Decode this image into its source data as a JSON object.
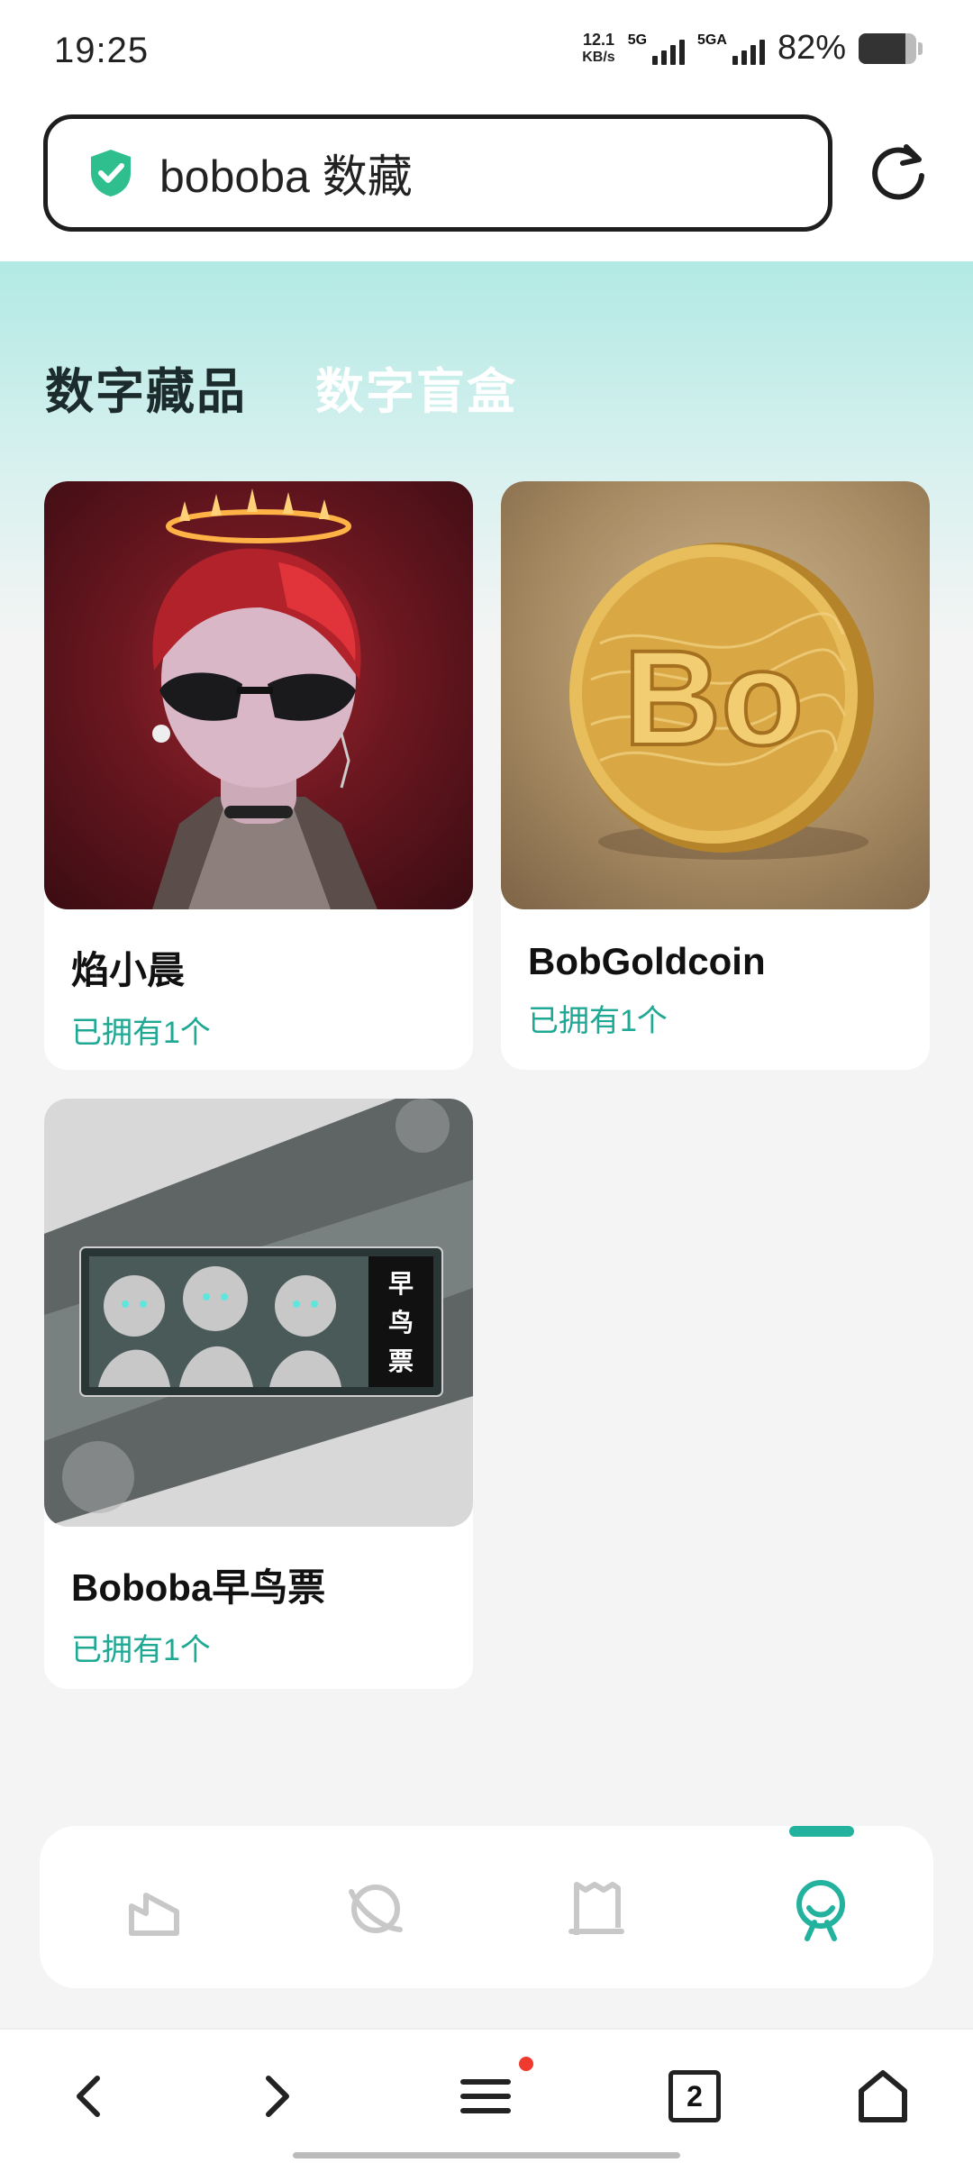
{
  "status_bar": {
    "time": "19:25",
    "net_speed_value": "12.1",
    "net_speed_unit": "KB/s",
    "sim1_label": "5G",
    "sim2_label": "5GA",
    "battery_percent_text": "82%",
    "battery_level": 0.82
  },
  "address_bar": {
    "url_text": "boboba 数藏",
    "secure_icon": "shield-check-icon",
    "reload_icon": "reload-icon"
  },
  "category_tabs": [
    {
      "label": "数字藏品",
      "active": true
    },
    {
      "label": "数字盲盒",
      "active": false
    }
  ],
  "collectibles": [
    {
      "name": "焰小晨",
      "owned": "已拥有1个",
      "image": "avatar-character-artwork"
    },
    {
      "name": "BobGoldcoin",
      "owned": "已拥有1个",
      "image": "gold-coin-artwork"
    },
    {
      "name": "Boboba早鸟票",
      "owned": "已拥有1个",
      "image": "early-bird-ticket-artwork",
      "ticket_text": "早鸟票"
    }
  ],
  "bottom_tabs": [
    {
      "icon": "home-icon",
      "active": false
    },
    {
      "icon": "planet-icon",
      "active": false
    },
    {
      "icon": "receipt-icon",
      "active": false
    },
    {
      "icon": "profile-icon",
      "active": true
    }
  ],
  "browser_nav": {
    "tab_count": "2",
    "icons": [
      "back-icon",
      "forward-icon",
      "menu-icon",
      "tabs-icon",
      "home-icon"
    ]
  },
  "colors": {
    "accent": "#22b29e",
    "owned_text": "#1fa893",
    "notification_dot": "#f03a30"
  }
}
